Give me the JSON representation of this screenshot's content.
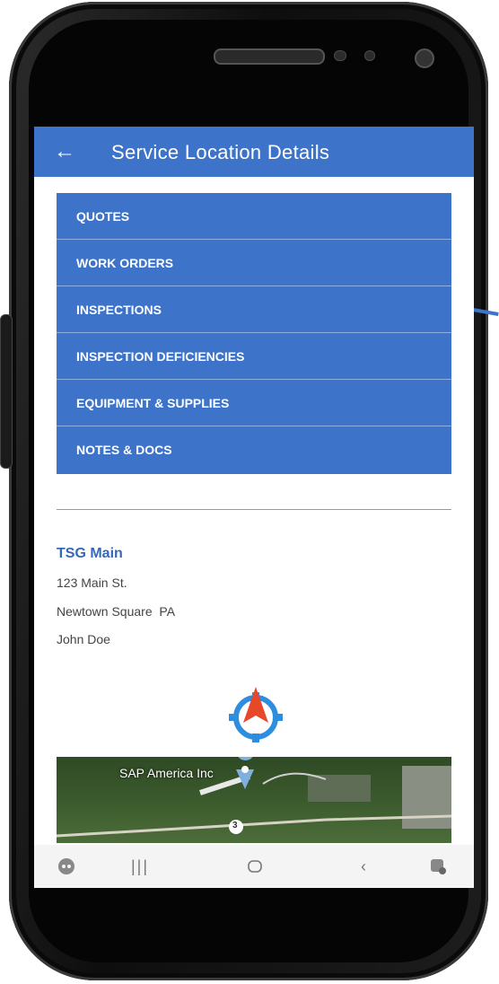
{
  "header": {
    "back_icon": "arrow-left-icon",
    "title": "Service Location Details"
  },
  "menu": {
    "items": [
      {
        "label": "QUOTES"
      },
      {
        "label": "WORK ORDERS"
      },
      {
        "label": "INSPECTIONS"
      },
      {
        "label": "INSPECTION DEFICIENCIES"
      },
      {
        "label": "EQUIPMENT & SUPPLIES"
      },
      {
        "label": "NOTES & DOCS"
      }
    ]
  },
  "location": {
    "name": "TSG Main",
    "street": "123 Main St.",
    "city_state": "Newtown Square  PA",
    "contact": "John Doe"
  },
  "map": {
    "place_label": "SAP America Inc",
    "road_number": "3",
    "pin_icon": "map-pin-icon",
    "compass_icon": "navigation-compass-icon"
  },
  "nav_bar": {
    "icons": [
      "game-launcher-icon",
      "recents-icon",
      "home-icon",
      "back-chevron-icon",
      "accessibility-icon"
    ]
  },
  "colors": {
    "primary": "#3d73c8",
    "location_name": "#3568b6",
    "compass_arrow": "#e8482a",
    "compass_ring": "#2f8de0"
  }
}
